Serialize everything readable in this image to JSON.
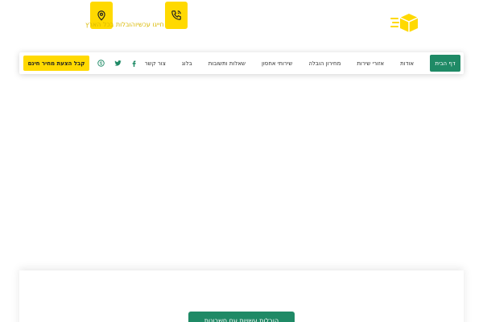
{
  "header": {
    "phone_text": "חייגו עכשיו",
    "location_text": "הובלות בכל הארץ"
  },
  "nav": {
    "home_label": "דף הבית",
    "items": [
      {
        "label": "אודות"
      },
      {
        "label": "אזורי שירות"
      },
      {
        "label": "מחירון הובלה"
      },
      {
        "label": "שירותי אחסון"
      },
      {
        "label": "שאלות ותשובות"
      },
      {
        "label": "בלוג"
      },
      {
        "label": "צור קשר"
      }
    ],
    "cta_label": "קבל הצעת מחיר חינם"
  },
  "content": {
    "button_label": "הובלות עשויות עם חשבונות"
  },
  "colors": {
    "accent_yellow": "#ffd900",
    "brand_green": "#1f8a66",
    "social_green": "#1f8a66"
  },
  "icons": {
    "phone": "phone-icon",
    "location": "location-pin-icon",
    "logo": "delivery-box-icon",
    "facebook": "facebook-icon",
    "twitter": "twitter-icon",
    "skype": "skype-icon"
  }
}
